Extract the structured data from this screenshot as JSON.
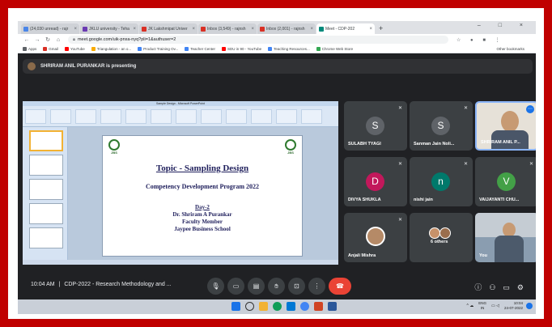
{
  "browser": {
    "tabs": [
      {
        "label": "(24,030 unread) - rajr",
        "color": "#4a86e8"
      },
      {
        "label": "JKLU university - Teha",
        "color": "#6a3ab2"
      },
      {
        "label": "JK Lakshmipat Univer",
        "color": "#d93025"
      },
      {
        "label": "Inbox (3,549) - rajnsh",
        "color": "#d93025"
      },
      {
        "label": "Inbox (2,001) - rajnsh",
        "color": "#d93025"
      },
      {
        "label": "Meet - CDP-202",
        "color": "#00897b",
        "active": true
      }
    ],
    "new_tab": "+",
    "window_controls": "– □ ×",
    "url": "meet.google.com/uik-pnxa-nyq?pli=1&authuser=2",
    "bookmarks": [
      {
        "label": "Apps",
        "color": "#5f6368"
      },
      {
        "label": "Gmail",
        "color": "#d93025"
      },
      {
        "label": "YouTube",
        "color": "#ff0000"
      },
      {
        "label": "Triangulation - an o...",
        "color": "#f9ab00"
      },
      {
        "label": "Product Training Ov...",
        "color": "#4285f4"
      },
      {
        "label": "Teacher Center",
        "color": "#4285f4"
      },
      {
        "label": "SDU in 90 - YouTube",
        "color": "#ff0000"
      },
      {
        "label": "Teaching Resources...",
        "color": "#4285f4"
      },
      {
        "label": "Chrome Web Store",
        "color": "#34a853"
      }
    ],
    "other_bookmarks": "Other bookmarks"
  },
  "presenting": {
    "text": "SHRIRAM ANIL PURANKAR is presenting"
  },
  "shared_screen": {
    "window_title": "Sample Design - Microsoft PowerPoint",
    "slide": {
      "title": "Topic - Sampling Design",
      "subtitle": "Competency Development Program 2022",
      "day": "Day-2",
      "presenter": "Dr. Shriram A Purankar",
      "role": "Faculty Member",
      "school": "Jaypee Business School",
      "logo_text": "JBS"
    }
  },
  "participants": [
    {
      "name": "SULABH TYAGI",
      "initial": "S",
      "color": "#5f6368",
      "muted": true
    },
    {
      "name": "Sanman Jain Noli...",
      "initial": "S",
      "color": "#5f6368",
      "muted": true
    },
    {
      "name": "SHRIRAM ANIL P...",
      "initial": "",
      "color": "#6b5a4a",
      "muted": false,
      "video": true
    },
    {
      "name": "DIVYA SHUKLA",
      "initial": "D",
      "color": "#c2185b",
      "muted": true
    },
    {
      "name": "nishi jain",
      "initial": "n",
      "color": "#00796b",
      "muted": true
    },
    {
      "name": "VAIJAYANTI CHU...",
      "initial": "V",
      "color": "#43a047",
      "muted": true
    },
    {
      "name": "Anjali Mishra",
      "initial": "",
      "color": "#5f6368",
      "muted": true,
      "video": true
    },
    {
      "name": "6 others",
      "initial": "",
      "color": "#5f6368",
      "muted": false
    },
    {
      "name": "You",
      "initial": "",
      "color": "#8a9db0",
      "muted": false,
      "video": true
    }
  ],
  "bottom_bar": {
    "time": "10:04 AM",
    "separator": "|",
    "meeting_title": "CDP-2022 - Research Methodology and ...",
    "controls": [
      "mic-icon",
      "camera-icon",
      "captions-icon",
      "raise-hand-icon",
      "present-icon",
      "more-icon",
      "end-call-icon"
    ]
  },
  "taskbar": {
    "lang": "ENG",
    "region": "IN",
    "clock": "10:04",
    "date": "24-07-2022"
  }
}
